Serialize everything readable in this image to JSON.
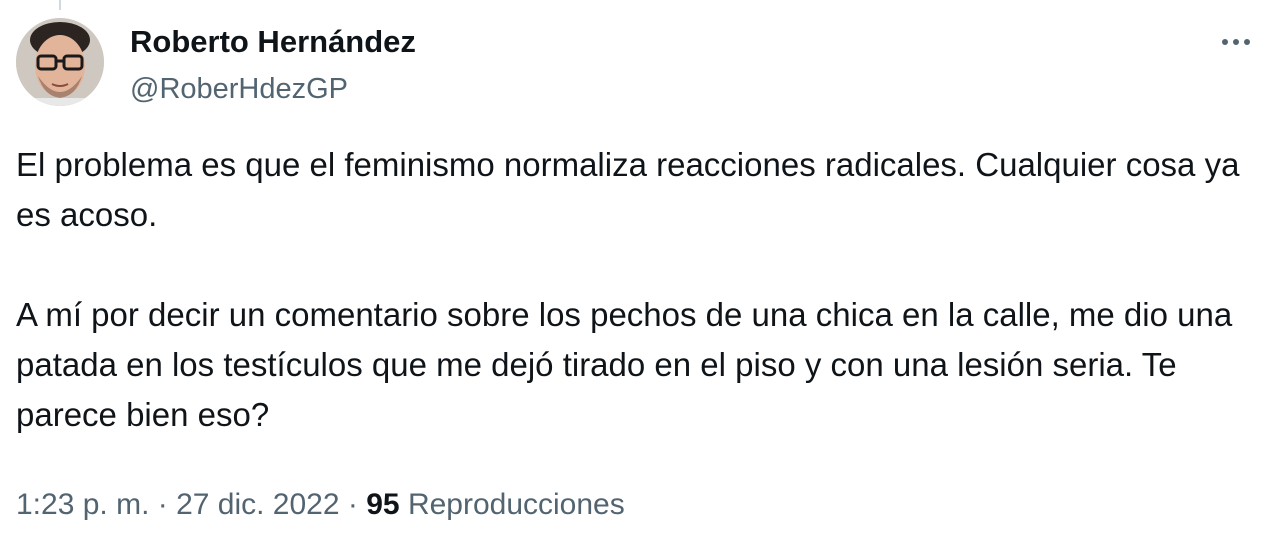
{
  "author": {
    "display_name": "Roberto Hernández",
    "handle": "@RoberHdezGP"
  },
  "tweet": {
    "paragraph_1": "El problema es que el feminismo normaliza reacciones radicales. Cualquier cosa ya es acoso.",
    "paragraph_2": "A mí por decir un comentario sobre los pechos de una chica en la calle, me dio una patada en los testículos que me dejó tirado en el piso y con una lesión seria. Te parece bien eso?"
  },
  "meta": {
    "time": "1:23 p. m.",
    "separator": " · ",
    "date": "27 dic. 2022",
    "views_count": "95",
    "views_label": "Reproducciones"
  },
  "icons": {
    "more": "more-horizontal-icon"
  },
  "colors": {
    "text_primary": "#0f1419",
    "text_secondary": "#536471",
    "background": "#ffffff"
  }
}
